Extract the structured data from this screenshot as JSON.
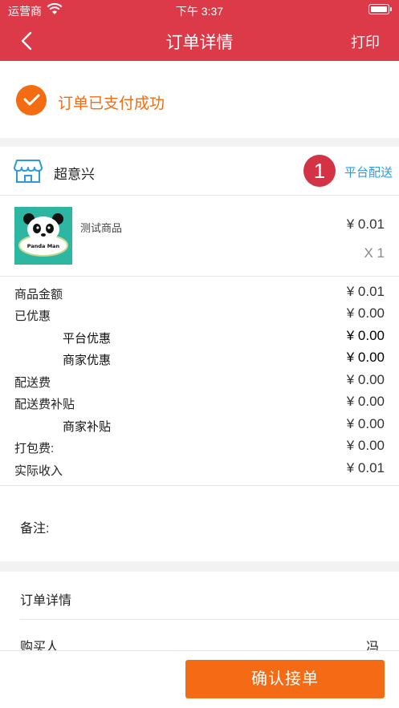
{
  "status_bar": {
    "carrier": "运营商",
    "time": "下午 3:37"
  },
  "nav": {
    "title": "订单详情",
    "print_label": "打印"
  },
  "success": {
    "message": "订单已支付成功"
  },
  "store": {
    "name": "超意兴",
    "badge_count": "1",
    "delivery_label": "平台配送"
  },
  "product": {
    "name": "测试商品",
    "price": "¥ 0.01",
    "qty": "X 1",
    "thumb_text": "Panda Man"
  },
  "fees": [
    {
      "label": "商品金额",
      "value": "¥ 0.01"
    },
    {
      "label": "已优惠",
      "value": "¥ 0.00"
    },
    {
      "label": "平台优惠",
      "value": "¥ 0.00"
    },
    {
      "label": "商家优惠",
      "value": "¥ 0.00"
    },
    {
      "label": "配送费",
      "value": "¥ 0.00"
    },
    {
      "label": "配送费补贴",
      "value": "¥ 0.00"
    },
    {
      "label": "商家补贴",
      "value": "¥ 0.00"
    },
    {
      "label": "打包费:",
      "value": "¥ 0.00"
    },
    {
      "label": "实际收入",
      "value": "¥ 0.01"
    }
  ],
  "remark": {
    "label": "备注:"
  },
  "detail": {
    "title": "订单详情",
    "buyer_label": "购买人",
    "buyer_value": "冯"
  },
  "footer": {
    "confirm_label": "确认接单"
  },
  "colors": {
    "header": "#dc3a48",
    "accent": "#f36c12",
    "link": "#2a9be0",
    "badge": "#d43345"
  }
}
